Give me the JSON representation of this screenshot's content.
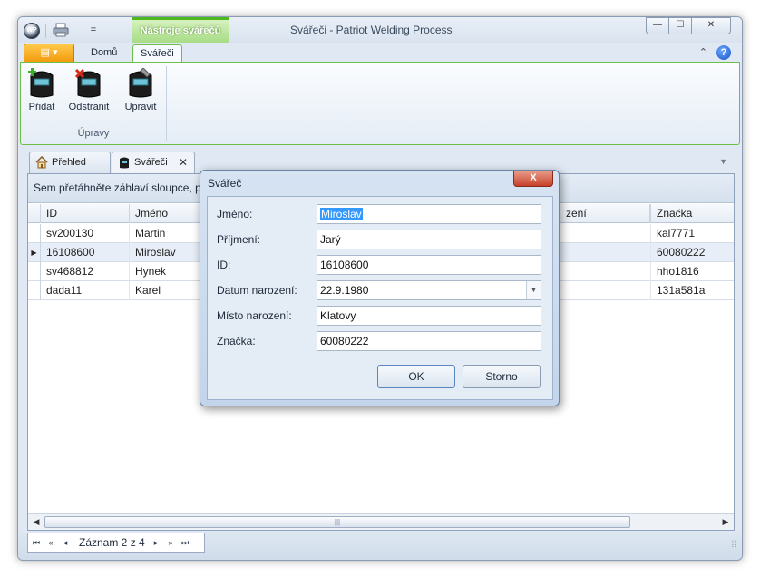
{
  "window": {
    "title": "Svářeči - Patriot Welding Process",
    "context_tab": "Nástroje svářečů",
    "app_logo": "WP",
    "qat_more": "=",
    "buttons": {
      "minimize": "—",
      "maximize": "☐",
      "close": "✕"
    }
  },
  "ribbon": {
    "file_button": "▤ ▾",
    "tabs": [
      "Domů",
      "Svářeči"
    ],
    "active_tab": "Svářeči",
    "minimize_glyph": "⌃",
    "help_glyph": "?",
    "group": {
      "label": "Úpravy",
      "buttons": [
        {
          "label": "Přidat",
          "icon": "welding-helmet-add-icon"
        },
        {
          "label": "Odstranit",
          "icon": "welding-helmet-remove-icon"
        },
        {
          "label": "Upravit",
          "icon": "welding-helmet-edit-icon"
        }
      ]
    }
  },
  "doc_tabs": {
    "overview": "Přehled",
    "welders": "Svářeči",
    "close_glyph": "✕",
    "menu_glyph": "▼"
  },
  "grid": {
    "group_hint": "Sem přetáhněte záhlaví sloupce, po",
    "columns": [
      "ID",
      "Jméno",
      "zení",
      "Značka"
    ],
    "rows": [
      {
        "id": "sv200130",
        "name": "Martin",
        "mark": "kal7771",
        "selected": false
      },
      {
        "id": "16108600",
        "name": "Miroslav",
        "mark": "60080222",
        "selected": true
      },
      {
        "id": "sv468812",
        "name": "Hynek",
        "mark": "hho1816",
        "selected": false
      },
      {
        "id": "dada11",
        "name": "Karel",
        "mark": "131a581a",
        "selected": false
      }
    ],
    "row_indicator": "▶",
    "scroll_left": "◀",
    "scroll_right": "▶",
    "scroll_grip": "|||"
  },
  "navigator": {
    "text": "Záznam 2 z 4",
    "first": "⏮",
    "prev_page": "«",
    "prev": "◂",
    "next": "▸",
    "next_page": "»",
    "last": "⏭",
    "grip": "⁞⁞"
  },
  "dialog": {
    "title": "Svářeč",
    "close_glyph": "X",
    "fields": {
      "first_name": {
        "label": "Jméno:",
        "value": "Miroslav"
      },
      "last_name": {
        "label": "Příjmení:",
        "value": "Jarý"
      },
      "id": {
        "label": "ID:",
        "value": "16108600"
      },
      "birth_date": {
        "label": "Datum narození:",
        "value": "22.9.1980"
      },
      "birth_place": {
        "label": "Místo narození:",
        "value": "Klatovy"
      },
      "mark": {
        "label": "Značka:",
        "value": "60080222"
      }
    },
    "dropdown_glyph": "▼",
    "ok": "OK",
    "cancel": "Storno"
  },
  "colors": {
    "ribbon_accent": "#6fbe47",
    "file_button": "#f29b0d",
    "selection": "#3399ff",
    "dialog_close": "#c7402a"
  }
}
